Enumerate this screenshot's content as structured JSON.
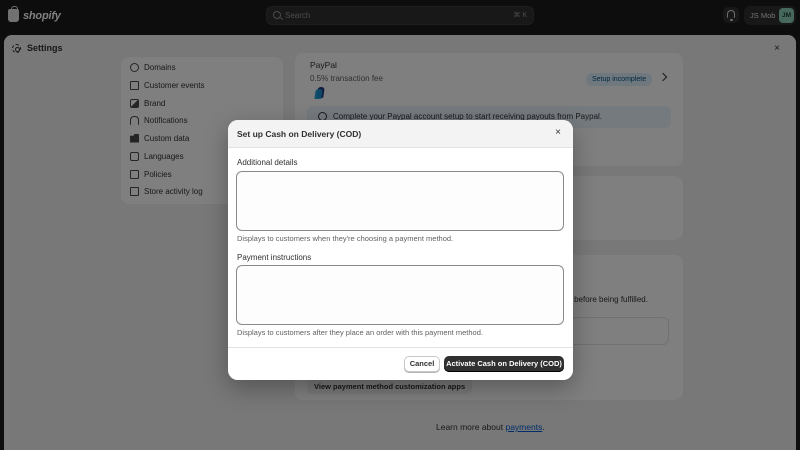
{
  "topbar": {
    "logo_text": "shopify",
    "search_placeholder": "Search",
    "search_shortcut": "⌘ K",
    "user_name": "JS Mob",
    "user_initials": "JM"
  },
  "settings": {
    "title": "Settings",
    "close_symbol": "×",
    "nav": [
      {
        "label": "Domains",
        "icon": "globe-icon"
      },
      {
        "label": "Customer events",
        "icon": "events-icon"
      },
      {
        "label": "Brand",
        "icon": "brand-icon"
      },
      {
        "label": "Notifications",
        "icon": "bell-icon"
      },
      {
        "label": "Custom data",
        "icon": "folder-icon"
      },
      {
        "label": "Languages",
        "icon": "language-icon"
      },
      {
        "label": "Policies",
        "icon": "policies-icon"
      },
      {
        "label": "Store activity log",
        "icon": "activity-log-icon"
      }
    ],
    "paypal": {
      "name": "PayPal",
      "fee": "0.5% transaction fee",
      "status": "Setup incomplete",
      "banner": "Complete your Paypal account setup to start receiving payouts from Paypal."
    },
    "fulfil_text": "ved before being fulfilled.",
    "customize_button": "View payment method customization apps",
    "learn_more_prefix": "Learn more about ",
    "learn_more_link": "payments",
    "learn_more_suffix": "."
  },
  "modal": {
    "title": "Set up Cash on Delivery (COD)",
    "close_symbol": "×",
    "additional_details_label": "Additional details",
    "additional_details_value": "",
    "additional_details_help": "Displays to customers when they're choosing a payment method.",
    "payment_instructions_label": "Payment instructions",
    "payment_instructions_value": "",
    "payment_instructions_help": "Displays to customers after they place an order with this payment method.",
    "cancel_label": "Cancel",
    "activate_label": "Activate Cash on Delivery (COD)"
  },
  "colors": {
    "topbar_bg": "#1a1a1a",
    "primary_button": "#303030",
    "link": "#005bd3",
    "badge_bg": "#e0f0ff"
  }
}
